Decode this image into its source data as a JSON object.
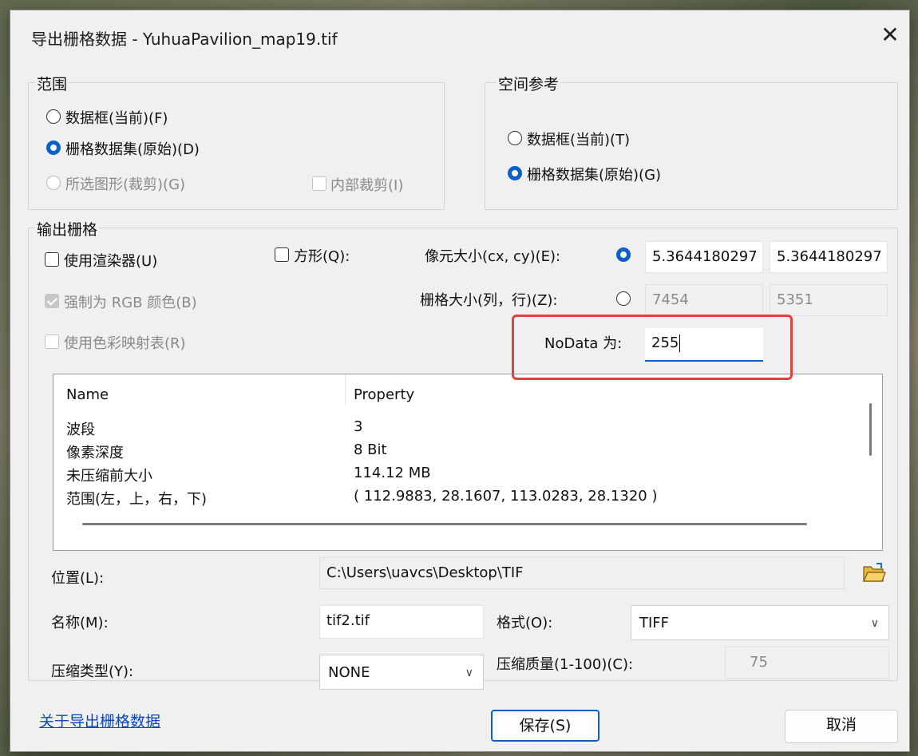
{
  "window": {
    "title": "导出栅格数据 - YuhuaPavilion_map19.tif",
    "close_label": "✕"
  },
  "extent": {
    "legend": "范围",
    "data_frame": "数据框(当前)(F)",
    "raster_dataset": "栅格数据集(原始)(D)",
    "selected_graphics": "所选图形(裁剪)(G)",
    "clip_inside": "内部裁剪(I)"
  },
  "spatial_reference": {
    "legend": "空间参考",
    "data_frame": "数据框(当前)(T)",
    "raster_dataset": "栅格数据集(原始)(G)"
  },
  "output_raster": {
    "legend": "输出栅格",
    "use_renderer": "使用渲染器(U)",
    "square": "方形(Q):",
    "cell_size_label": "像元大小(cx, cy)(E):",
    "cell_size_x": "5.3644180297",
    "cell_size_y": "5.3644180297",
    "force_rgb": "强制为 RGB 颜色(B)",
    "raster_size_label": "栅格大小(列，行)(Z):",
    "columns": "7454",
    "rows": "5351",
    "use_colormap": "使用色彩映射表(R)",
    "nodata_label": "NoData 为:",
    "nodata_value": "255"
  },
  "properties": {
    "headers": [
      "Name",
      "Property"
    ],
    "rows": [
      [
        "波段",
        "3"
      ],
      [
        "像素深度",
        "8 Bit"
      ],
      [
        "未压缩前大小",
        "114.12 MB"
      ],
      [
        "范围(左，上，右，下)",
        "( 112.9883, 28.1607, 113.0283, 28.1320 )"
      ]
    ]
  },
  "location": {
    "label": "位置(L):",
    "value": "C:\\Users\\uavcs\\Desktop\\TIF"
  },
  "name": {
    "label": "名称(M):",
    "value": "tif2.tif"
  },
  "format": {
    "label": "格式(O):",
    "value": "TIFF"
  },
  "compression_type": {
    "label": "压缩类型(Y):",
    "value": "NONE"
  },
  "compression_quality": {
    "label": "压缩质量(1-100)(C):",
    "value": "75"
  },
  "footer": {
    "help_link": "关于导出栅格数据",
    "save": "保存(S)",
    "cancel": "取消"
  },
  "colors": {
    "accent": "#0a5fc8",
    "highlight": "#e0433f",
    "link": "#0a46c8"
  }
}
